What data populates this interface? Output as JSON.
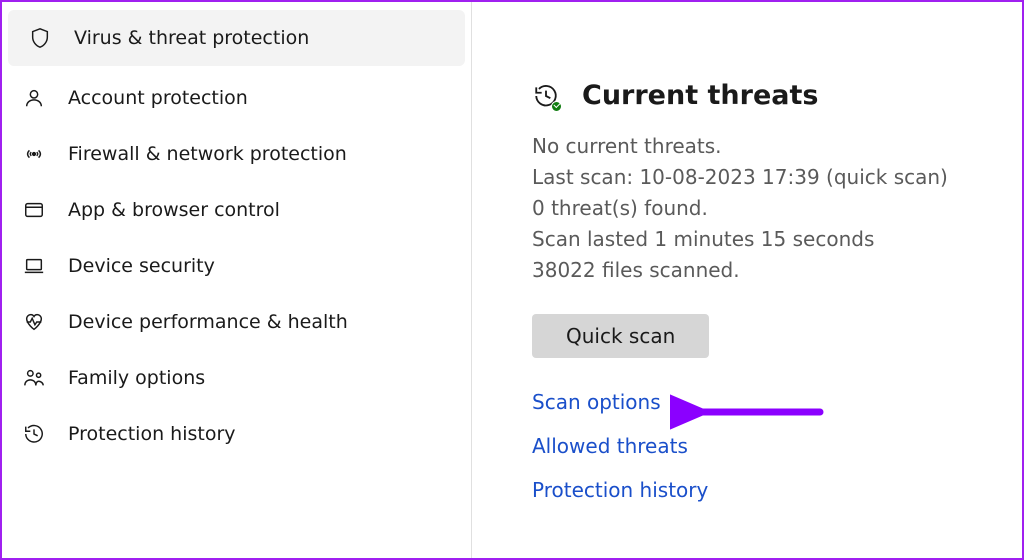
{
  "sidebar": {
    "items": [
      {
        "label": "Virus & threat protection",
        "icon": "shield-icon"
      },
      {
        "label": "Account protection",
        "icon": "person-icon"
      },
      {
        "label": "Firewall & network protection",
        "icon": "antenna-icon"
      },
      {
        "label": "App & browser control",
        "icon": "browser-icon"
      },
      {
        "label": "Device security",
        "icon": "laptop-icon"
      },
      {
        "label": "Device performance & health",
        "icon": "heart-icon"
      },
      {
        "label": "Family options",
        "icon": "family-icon"
      },
      {
        "label": "Protection history",
        "icon": "history-icon"
      }
    ]
  },
  "main": {
    "section_title": "Current threats",
    "no_threats": "No current threats.",
    "last_scan": "Last scan: 10-08-2023 17:39 (quick scan)",
    "threats_found": "0 threat(s) found.",
    "scan_duration": "Scan lasted 1 minutes 15 seconds",
    "files_scanned": "38022 files scanned.",
    "quick_scan_label": "Quick scan",
    "links": {
      "scan_options": "Scan options",
      "allowed_threats": "Allowed threats",
      "protection_history": "Protection history"
    }
  },
  "colors": {
    "annotation": "#8b00ff",
    "link": "#1a4fca",
    "muted": "#5a5a5a"
  }
}
